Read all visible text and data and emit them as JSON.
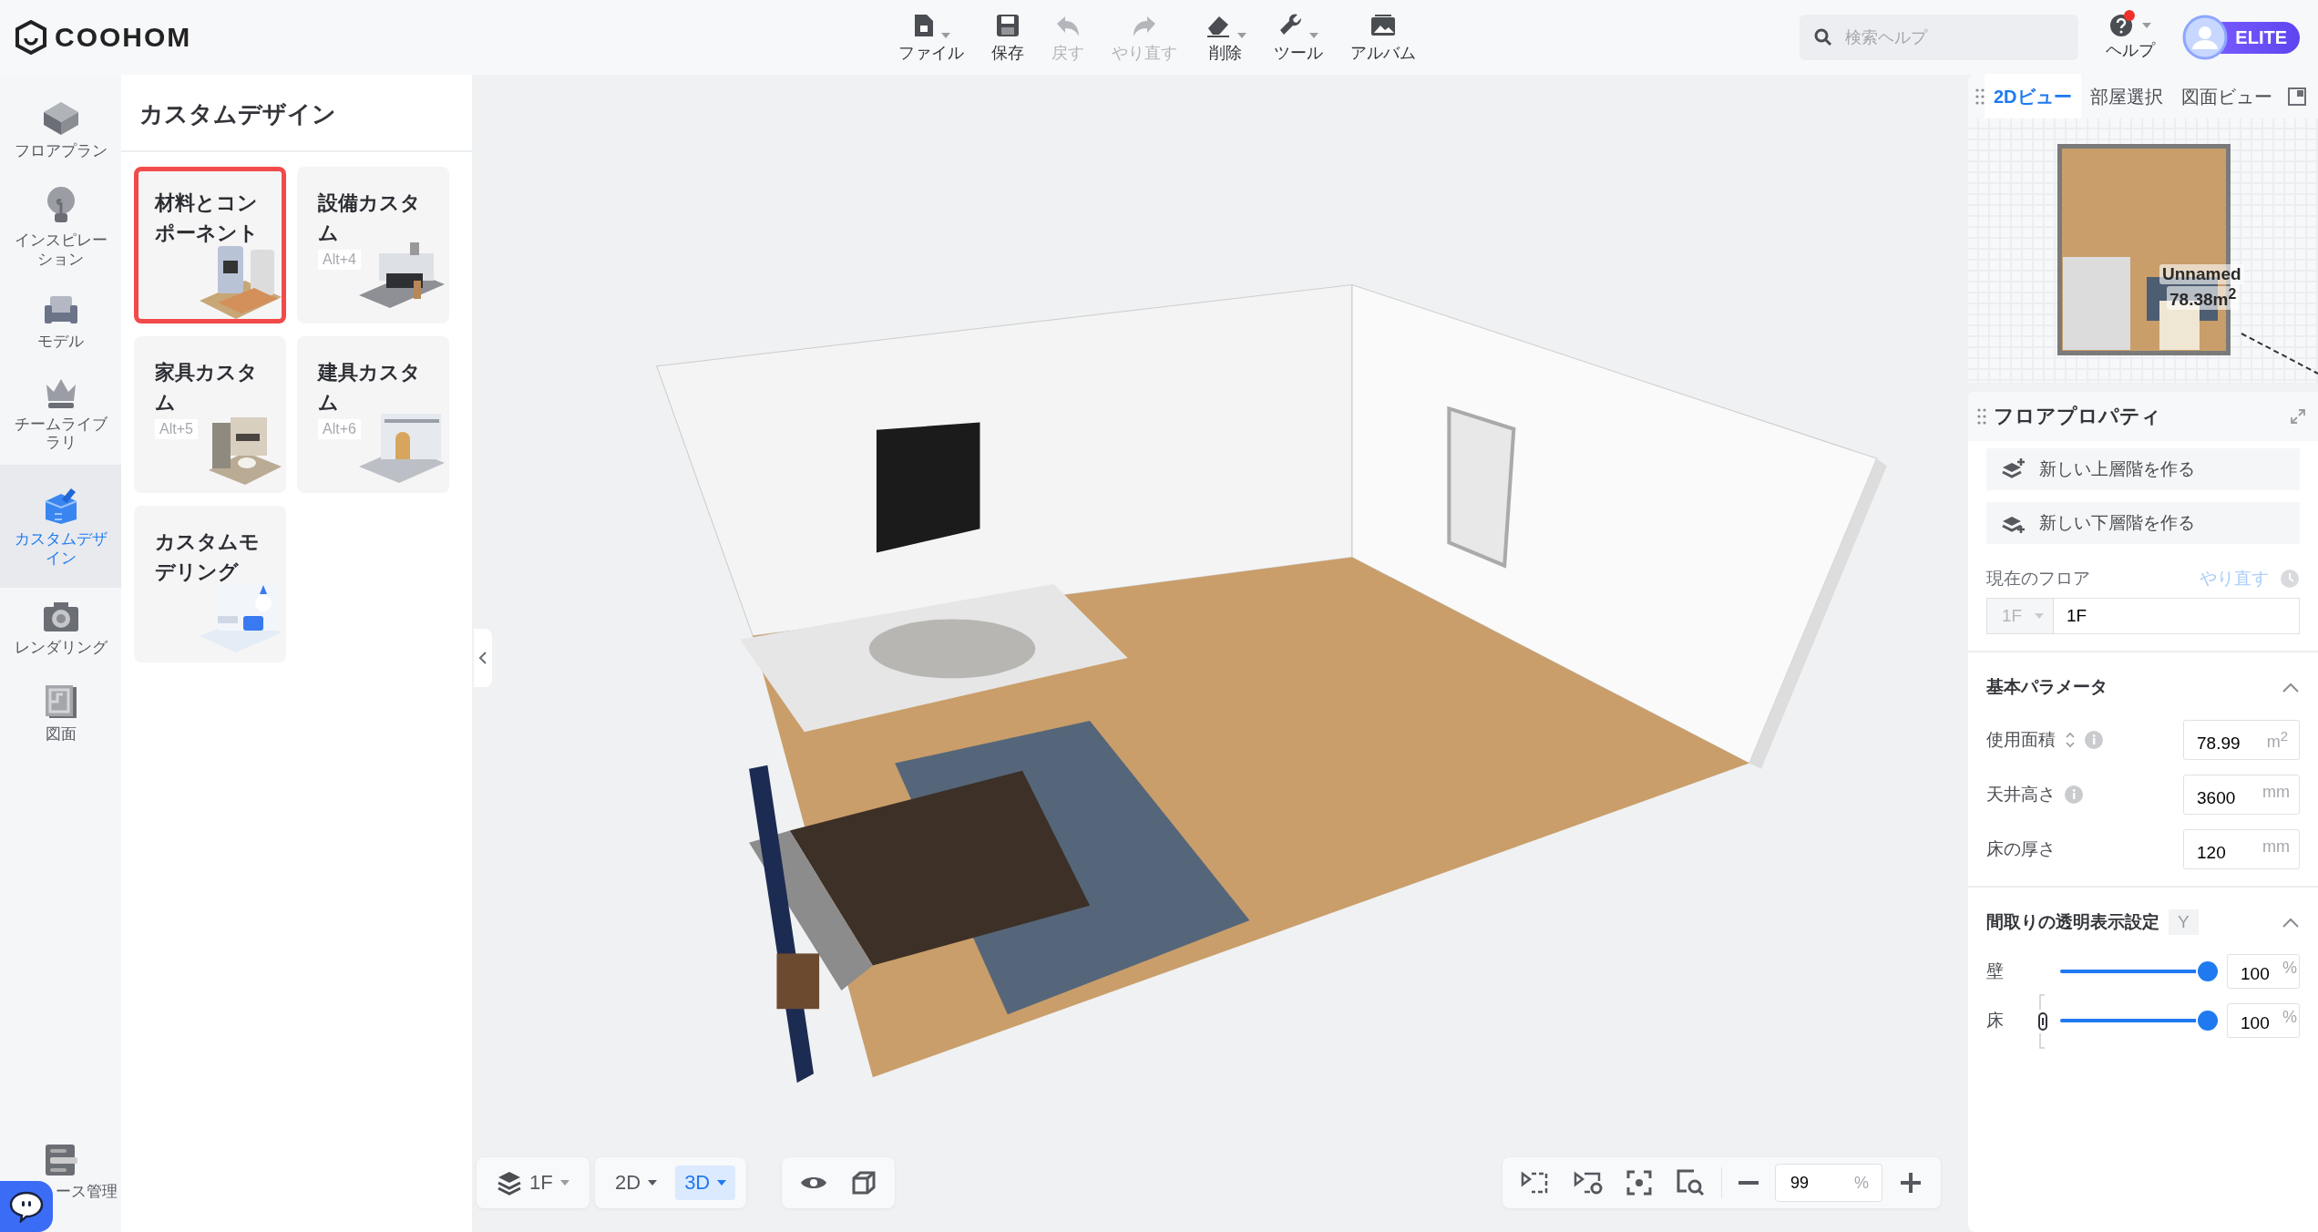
{
  "app": {
    "logo": "COOHOM"
  },
  "toolbar": [
    {
      "label": "ファイル",
      "dropdown": true,
      "disabled": false
    },
    {
      "label": "保存",
      "dropdown": false,
      "disabled": false
    },
    {
      "label": "戻す",
      "dropdown": false,
      "disabled": true
    },
    {
      "label": "やり直す",
      "dropdown": false,
      "disabled": true
    },
    {
      "label": "削除",
      "dropdown": true,
      "disabled": false
    },
    {
      "label": "ツール",
      "dropdown": true,
      "disabled": false
    },
    {
      "label": "アルバム",
      "dropdown": false,
      "disabled": false
    }
  ],
  "search": {
    "placeholder": "検索ヘルプ"
  },
  "help": {
    "label": "ヘルプ",
    "notification": true
  },
  "plan_badge": "ELITE",
  "sidebar": {
    "items": [
      {
        "label": "フロアプラン",
        "selected": false
      },
      {
        "label": "インスピレーション",
        "selected": false
      },
      {
        "label": "モデル",
        "selected": false
      },
      {
        "label": "チームライブラリ",
        "selected": false
      },
      {
        "label": "カスタムデザイン",
        "selected": true
      },
      {
        "label": "レンダリング",
        "selected": false
      },
      {
        "label": "図面",
        "selected": false
      }
    ],
    "bottom_item": {
      "label": "ース管理"
    }
  },
  "panel": {
    "title": "カスタムデザイン",
    "cards": [
      {
        "title": "材料とコンポーネント",
        "selected": true
      },
      {
        "title": "設備カスタム",
        "shortcut": "Alt+4",
        "selected": false
      },
      {
        "title": "家具カスタム",
        "shortcut": "Alt+5",
        "selected": false
      },
      {
        "title": "建具カスタム",
        "shortcut": "Alt+6",
        "selected": false
      },
      {
        "title": "カスタムモデリング",
        "selected": false
      }
    ]
  },
  "view_controls": {
    "floor": "1F",
    "modes": [
      {
        "label": "2D",
        "selected": false
      },
      {
        "label": "3D",
        "selected": true
      }
    ],
    "zoom": {
      "value": "99",
      "unit": "%"
    }
  },
  "view_panel": {
    "tabs": [
      {
        "label": "2Dビュー",
        "selected": true
      },
      {
        "label": "部屋選択",
        "selected": false
      },
      {
        "label": "図面ビュー",
        "selected": false
      }
    ],
    "room_name": "Unnamed",
    "room_area": "78.38m$^{2}$"
  },
  "floor_properties": {
    "title": "フロアプロパティ",
    "actions": [
      "新しい上層階を作る",
      "新しい下層階を作る"
    ],
    "current_floor": {
      "label": "現在のフロア",
      "redo": "やり直す",
      "select": "1F",
      "value": "1F"
    },
    "basic": {
      "title": "基本パラメータ",
      "expanded": true,
      "rows": [
        {
          "label": "使用面積",
          "value": "78.99",
          "unit": "m$^{2}$",
          "sortable": true,
          "info": true
        },
        {
          "label": "天井高さ",
          "value": "3600",
          "unit": "mm",
          "sortable": false,
          "info": true
        },
        {
          "label": "床の厚さ",
          "value": "120",
          "unit": "mm",
          "sortable": false,
          "info": false
        }
      ]
    },
    "transparency": {
      "title": "間取りの透明表示設定",
      "shortcut": "Y",
      "expanded": true,
      "linked": true,
      "sliders": [
        {
          "label": "壁",
          "level": 1,
          "value": "100",
          "unit": "%"
        },
        {
          "label": "床",
          "level": 1,
          "value": "100",
          "unit": "%"
        }
      ]
    }
  }
}
